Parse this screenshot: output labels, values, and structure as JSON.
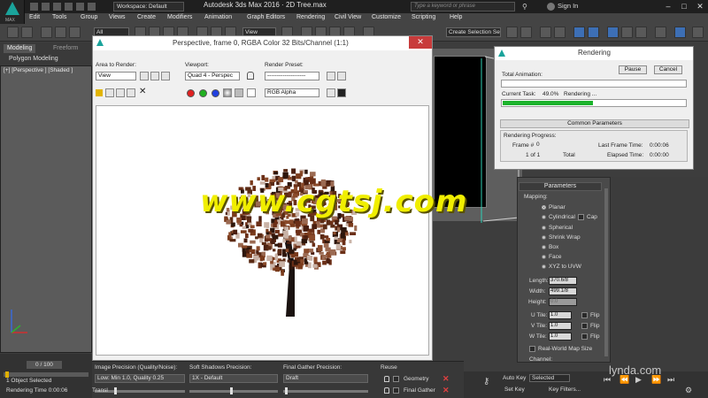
{
  "app": {
    "logo_label": "MAX",
    "workspace": "Workspace: Default",
    "title": "Autodesk 3ds Max 2016 · 2D Tree.max",
    "search_placeholder": "Type a keyword or phrase",
    "sign_in": "Sign In",
    "window_controls": [
      "–",
      "□",
      "✕"
    ]
  },
  "menu": [
    "Edit",
    "Tools",
    "Group",
    "Views",
    "Create",
    "Modifiers",
    "Animation",
    "Graph Editors",
    "Rendering",
    "Civil View",
    "Customize",
    "Scripting",
    "Help"
  ],
  "toolbar": {
    "filter": "All",
    "ref_coord": "View",
    "selection_set": "Create Selection Se"
  },
  "ribbon": {
    "tabs": [
      "Modeling",
      "Freeform"
    ],
    "sub": "Polygon Modeling"
  },
  "viewport_left": {
    "label": "[+] [Perspective ] [Shaded ]"
  },
  "render_window": {
    "title": "Perspective, frame 0, RGBA Color 32 Bits/Channel (1:1)",
    "area_label": "Area to Render:",
    "area_value": "View",
    "viewport_label": "Viewport:",
    "viewport_value": "Quad 4 - Perspec",
    "preset_label": "Render Preset:",
    "preset_value": "--------------------",
    "channel_value": "RGB Alpha",
    "close": "✕",
    "channel_colors": [
      "#e02020",
      "#20b020",
      "#2040e0"
    ]
  },
  "rendering_dialog": {
    "title": "Rendering",
    "pause": "Pause",
    "cancel": "Cancel",
    "total_animation": "Total Animation:",
    "current_task_label": "Current Task:",
    "current_task_value": "49.0%",
    "current_task_status": "Rendering ...",
    "current_task_progress": 0.49,
    "common_parameters": "Common Parameters",
    "rendering_progress": "Rendering Progress:",
    "frame_label": "Frame #",
    "frame_value": "0",
    "of_label": "1 of 1",
    "total": "Total",
    "last_frame_time_label": "Last Frame Time:",
    "last_frame_time": "0:00:06",
    "elapsed_time_label": "Elapsed Time:",
    "elapsed_time": "0:00:00"
  },
  "parameters": {
    "header": "Parameters",
    "mapping_label": "Mapping:",
    "options": [
      "Planar",
      "Cylindrical",
      "Spherical",
      "Shrink Wrap",
      "Box",
      "Face",
      "XYZ to UVW"
    ],
    "cap": "Cap",
    "length_label": "Length:",
    "length_value": "370.6/8",
    "width_label": "Width:",
    "width_value": "499.1/8",
    "height_label": "Height:",
    "height_value": "0.0",
    "u_tile_label": "U Tile:",
    "u_tile": "1.0",
    "v_tile_label": "V Tile:",
    "v_tile": "1.0",
    "w_tile_label": "W Tile:",
    "w_tile": "1.0",
    "flip": "Flip",
    "real_world": "Real-World Map Size",
    "channel": "Channel:"
  },
  "bottom_panel": {
    "image_precision_label": "Image Precision (Quality/Noise):",
    "image_precision_value": "Low: Min 1.0, Quality 0.25",
    "soft_shadows_label": "Soft Shadows Precision:",
    "soft_shadows_value": "1X - Default",
    "final_gather_label": "Final Gather Precision:",
    "final_gather_value": "Draft",
    "reuse_label": "Reuse",
    "geometry": "Geometry",
    "final_gather": "Final Gather"
  },
  "timeline": {
    "frame": "0 / 100"
  },
  "status": {
    "selected": "1 Object Selected",
    "rendering_time": "Rendering Time  0:00:06",
    "transl": "Transl"
  },
  "anim": {
    "auto_key": "Auto Key",
    "selected": "Selected",
    "set_key": "Set Key",
    "key_filters": "Key Filters..."
  },
  "watermark": "www.cgtsj.com",
  "lynda": "lynda.com"
}
